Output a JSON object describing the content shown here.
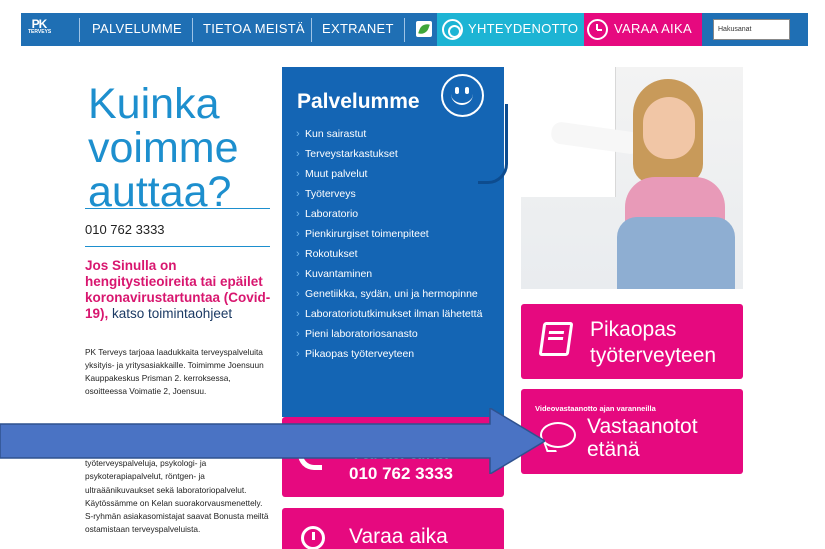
{
  "nav": {
    "logo_text": "PK",
    "logo_sub": "TERVEYS",
    "links": [
      "PALVELUMME",
      "TIETOA MEISTÄ",
      "EXTRANET"
    ],
    "contact_label": "YHTEYDENOTTO",
    "book_label": "VARAA AIKA",
    "search_placeholder": "Hakusanat",
    "colors": {
      "bar": "#1f6fb4",
      "contact": "#1db4d4",
      "book": "#e6097f"
    }
  },
  "hero": {
    "title": "Kuinka voimme auttaa?",
    "phone": "010 762 3333",
    "covid_highlight": "Jos Sinulla on hengitystieoireita tai epäilet koronavirustartuntaa (Covid-19),",
    "covid_link": " katso toimintaohjeet",
    "desc1": "PK Terveys tarjoaa laadukkaita terveyspalveluita yksityis- ja yritysasiakkaille. Toimimme Joensuun Kauppakeskus Prisman 2. kerroksessa, osoitteessa Voimatie 2, Joensuu.",
    "desc2": "Tarjoamme lääkäri- ja hoitajavastaanottoa, työterveyspalveluja, psykologi- ja psykoterapiapalvelut, röntgen- ja ultraäänikuvaukset sekä laboratoriopalvelut. Käytössämme on Kelan suorakorvausmenettely. S-ryhmän asiakasomistajat saavat Bonusta meiltä ostamistaan terveyspalveluista."
  },
  "services": {
    "title": "Palvelumme",
    "items": [
      "Kun sairastut",
      "Terveystarkastukset",
      "Muut palvelut",
      "Työterveys",
      "Laboratorio",
      "Pienkirurgiset toimenpiteet",
      "Rokotukset",
      "Kuvantaminen",
      "Genetiikka, sydän, uni ja hermopinne",
      "Laboratoriotutkimukset ilman lähetettä",
      "Pieni laboratoriosanasto",
      "Pikaopas työterveyteen"
    ],
    "color": "#1465b4"
  },
  "tiles": {
    "pikaopas": {
      "line1": "Pikaopas",
      "line2": "työterveyteen"
    },
    "etana": {
      "small": "Videovastaanotto ajan varanneilla",
      "line1": "Vastaanotot",
      "line2": "etänä"
    },
    "varaa_phone": {
      "line1": "Varaa aika",
      "phone": "010 762 3333"
    },
    "varaa_online": {
      "line1": "Varaa aika"
    },
    "color": "#e6097f"
  },
  "annotation": {
    "arrow_color": "#4a73c4",
    "arrow_border": "#2f528f"
  }
}
